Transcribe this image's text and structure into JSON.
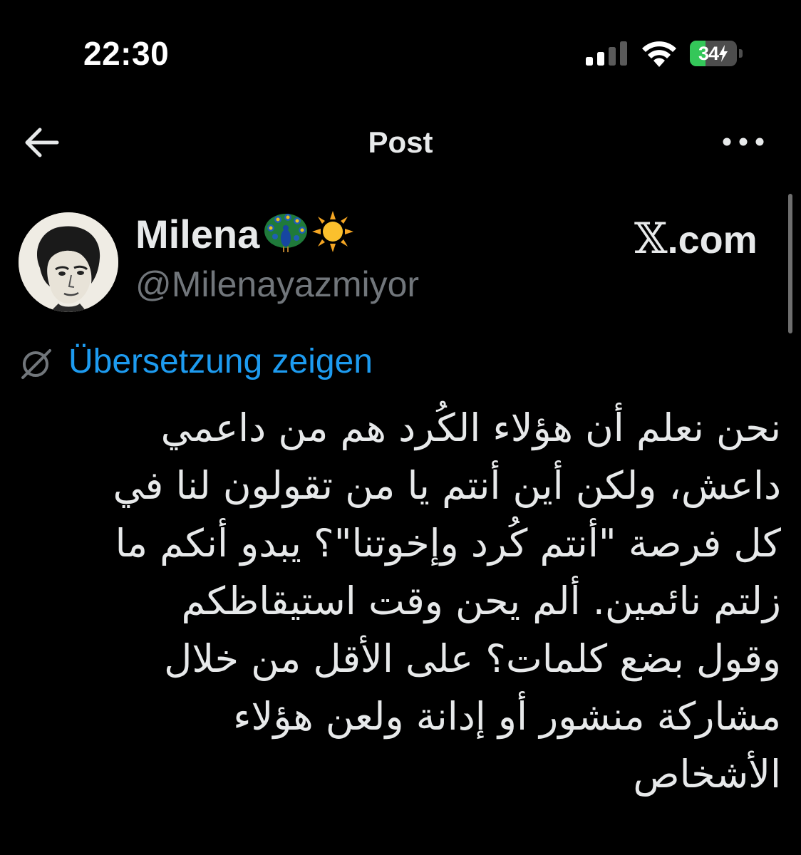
{
  "status_bar": {
    "time": "22:30",
    "battery_level": "34",
    "battery_fraction": 0.34,
    "accent_green": "#34c759",
    "icons": [
      "cellular-signal-icon",
      "wifi-icon",
      "battery-charging-icon"
    ]
  },
  "header": {
    "title": "Post",
    "back_icon": "arrow-left-icon",
    "menu_icon": "more-horizontal-icon"
  },
  "post": {
    "author": {
      "display_name": "Milena",
      "name_emojis": [
        "peacock-emoji",
        "sun-emoji"
      ],
      "handle": "@Milenayazmiyor",
      "avatar": "avatar-portrait-sketch"
    },
    "source": {
      "mark": "𝕏",
      "text": ".com"
    },
    "translate": {
      "label": "Übersetzung zeigen",
      "icon": "translate-globe-icon",
      "link_color": "#1d9bf0"
    },
    "text_lines": [
      "نحن نعلم أن هؤلاء الكُرد هم من داعمي",
      "داعش، ولكن أين أنتم يا من تقولون لنا في",
      "كل فرصة \"أنتم كُرد وإخوتنا\"؟ يبدو أنكم ما",
      "زلتم نائمين. ألم يحن وقت استيقاظكم",
      "وقول بضع كلمات؟ على الأقل من خلال",
      "مشاركة منشور أو إدانة ولعن هؤلاء",
      "الأشخاص"
    ]
  }
}
